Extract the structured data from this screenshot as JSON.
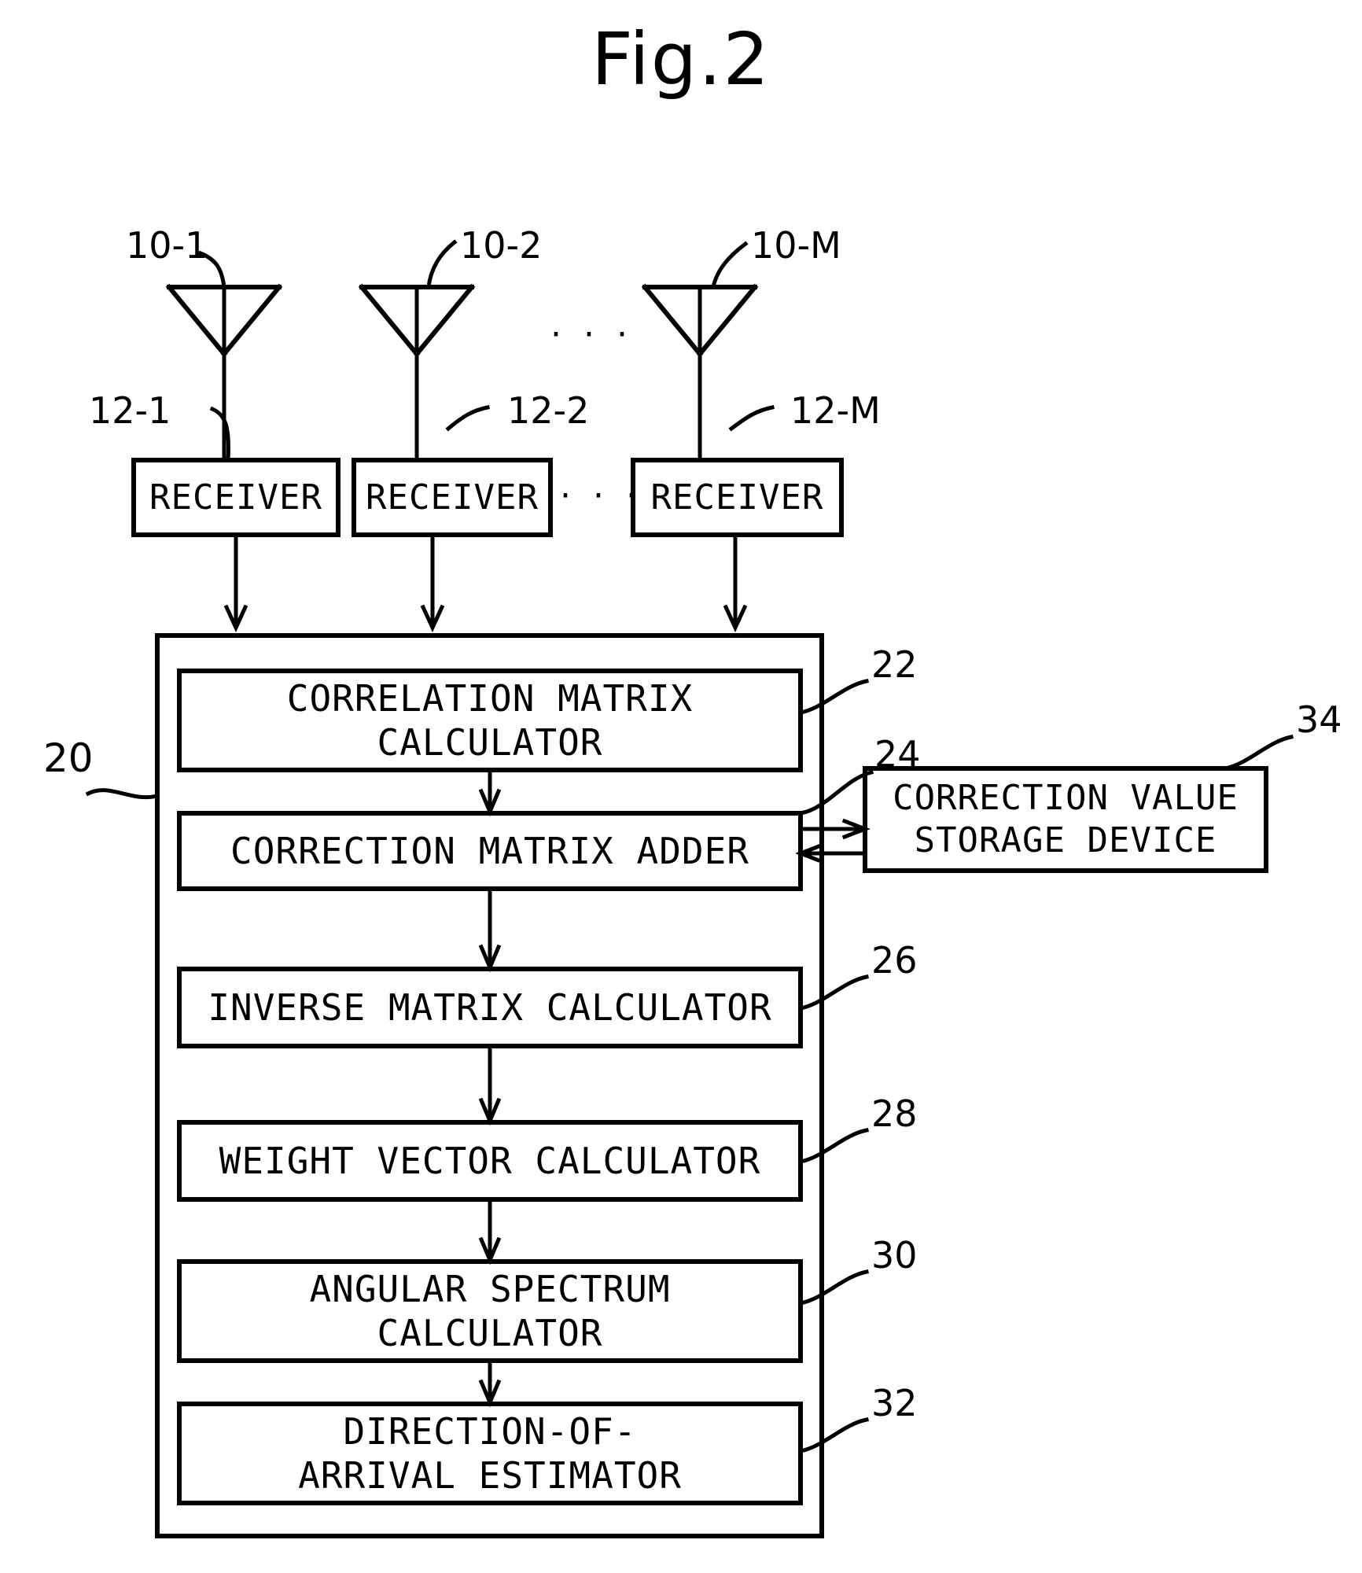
{
  "figure": {
    "title": "Fig.2",
    "system_ref": "20"
  },
  "antennas": [
    {
      "label": "10-1",
      "name": "antenna-10-1"
    },
    {
      "label": "10-2",
      "name": "antenna-10-2"
    },
    {
      "label": "10-M",
      "name": "antenna-10-M"
    }
  ],
  "antenna_ellipsis": "· · ·",
  "receivers": [
    {
      "label": "RECEIVER",
      "ref": "12-1"
    },
    {
      "label": "RECEIVER",
      "ref": "12-2"
    },
    {
      "label": "RECEIVER",
      "ref": "12-M"
    }
  ],
  "receiver_ellipsis": "· · ·",
  "blocks": [
    {
      "label": "CORRELATION MATRIX\nCALCULATOR",
      "ref": "22"
    },
    {
      "label": "CORRECTION MATRIX ADDER",
      "ref": "24"
    },
    {
      "label": "INVERSE MATRIX CALCULATOR",
      "ref": "26"
    },
    {
      "label": "WEIGHT VECTOR CALCULATOR",
      "ref": "28"
    },
    {
      "label": "ANGULAR SPECTRUM\nCALCULATOR",
      "ref": "30"
    },
    {
      "label": "DIRECTION-OF-\nARRIVAL ESTIMATOR",
      "ref": "32"
    }
  ],
  "storage": {
    "label": "CORRECTION VALUE\nSTORAGE DEVICE",
    "ref": "34"
  },
  "colors": {
    "ink": "#000000",
    "paper": "#ffffff"
  }
}
